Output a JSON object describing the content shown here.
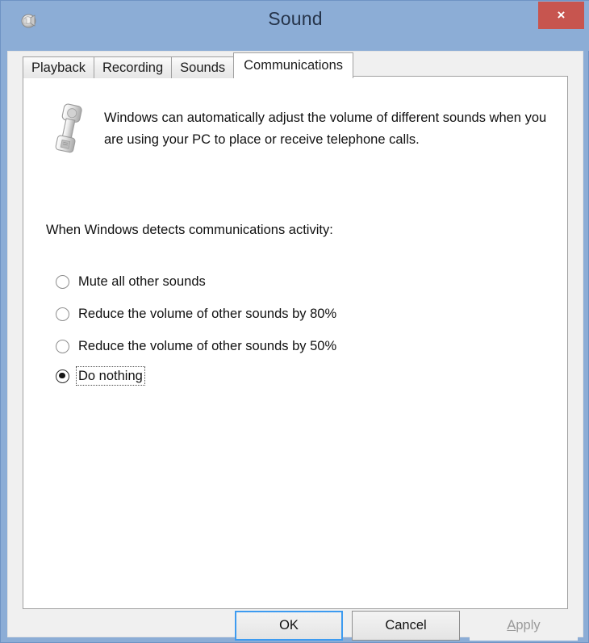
{
  "window": {
    "title": "Sound",
    "icon": "speaker-icon",
    "close_label": "×"
  },
  "tabs": [
    {
      "label": "Playback",
      "active": false
    },
    {
      "label": "Recording",
      "active": false
    },
    {
      "label": "Sounds",
      "active": false
    },
    {
      "label": "Communications",
      "active": true
    }
  ],
  "panel": {
    "icon": "telephone-handset-icon",
    "description": "Windows can automatically adjust the volume of different sounds when you are using your PC to place or receive telephone calls.",
    "group_label": "When Windows detects communications activity:",
    "options": [
      {
        "label": "Mute all other sounds",
        "selected": false,
        "focused": false
      },
      {
        "label": "Reduce the volume of other sounds by 80%",
        "selected": false,
        "focused": false
      },
      {
        "label": "Reduce the volume of other sounds by 50%",
        "selected": false,
        "focused": false
      },
      {
        "label": "Do nothing",
        "selected": true,
        "focused": true
      }
    ]
  },
  "footer": {
    "ok_label": "OK",
    "cancel_label": "Cancel",
    "apply_accel": "A",
    "apply_rest": "pply"
  },
  "colors": {
    "titlebar": "#8cadd6",
    "close_button": "#c7554f",
    "dialog_background": "#f0f0f0",
    "panel_background": "#ffffff",
    "default_button_border": "#3d9bf0",
    "disabled_text": "#9a9a9a"
  }
}
